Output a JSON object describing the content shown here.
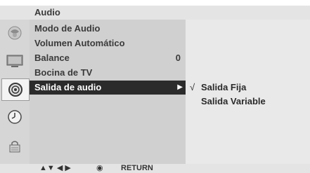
{
  "header": {
    "title": "Audio"
  },
  "sidebar": {
    "icons": [
      {
        "name": "picture-icon"
      },
      {
        "name": "tv-screen-icon"
      },
      {
        "name": "audio-icon",
        "active": true
      },
      {
        "name": "clock-icon"
      },
      {
        "name": "lock-icon"
      }
    ]
  },
  "menu": {
    "items": [
      {
        "label": "Modo de Audio",
        "value": ""
      },
      {
        "label": "Volumen Automático",
        "value": ""
      },
      {
        "label": "Balance",
        "value": "0"
      },
      {
        "label": "Bocina de TV",
        "value": ""
      },
      {
        "label": "Salida de audio",
        "value": "",
        "selected": true,
        "arrow": "▶"
      }
    ]
  },
  "submenu": {
    "items": [
      {
        "label": "Salida Fija",
        "checked": true,
        "check_mark": "√"
      },
      {
        "label": "Salida Variable",
        "checked": false,
        "check_mark": ""
      }
    ]
  },
  "footer": {
    "nav_glyphs": "▲▼ ◀ ▶",
    "ok_glyph": "◉",
    "return_label": "RETURN"
  },
  "colors": {
    "selected_bg": "#2b2b2b",
    "menu_bg": "#d0d0d0",
    "submenu_bg": "#e9e9e9",
    "header_bg": "#e4e4e4"
  }
}
